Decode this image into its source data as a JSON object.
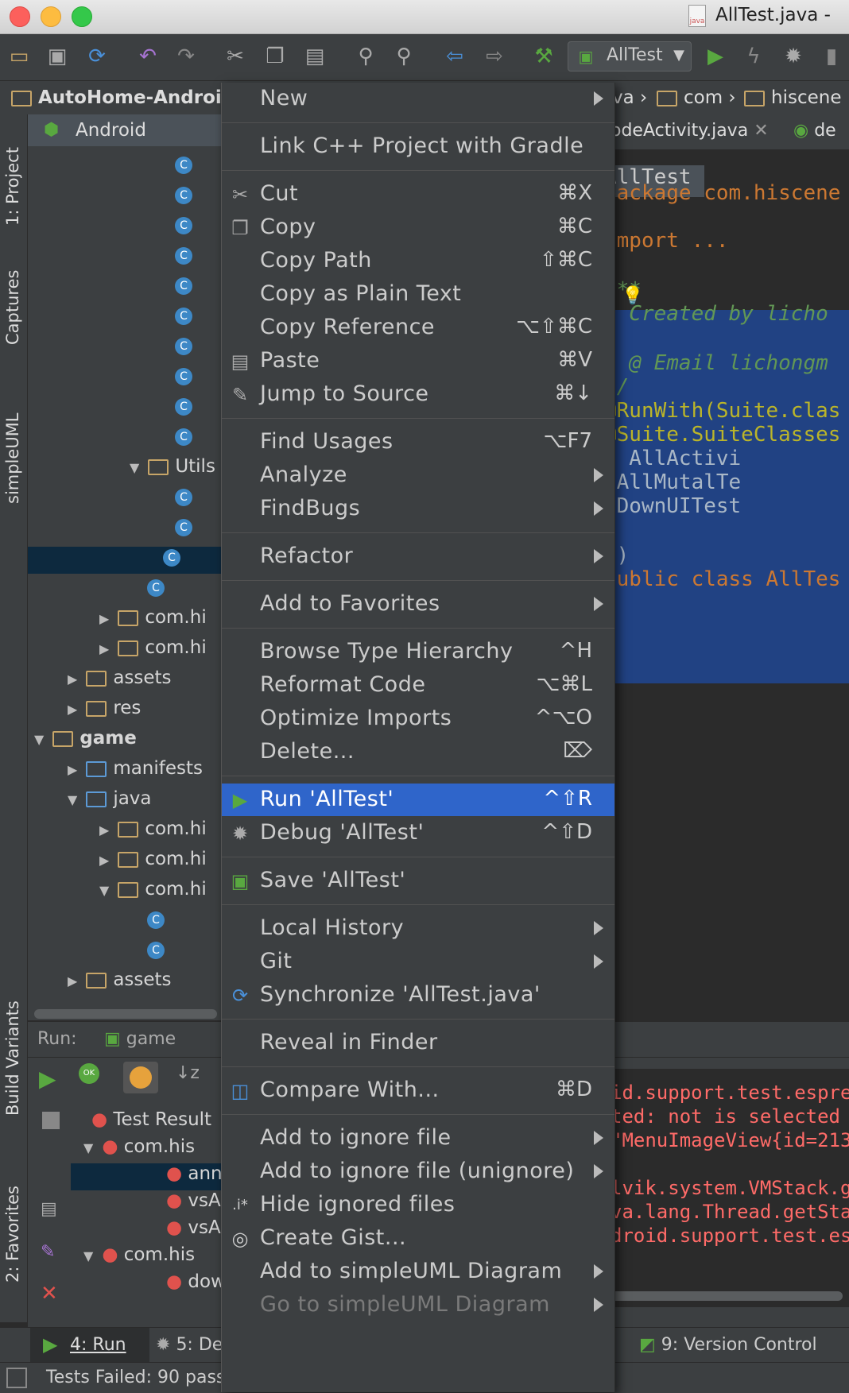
{
  "window": {
    "title": "AllTest.java -"
  },
  "toolbar": {
    "run_config": "AllTest"
  },
  "breadcrumbs": [
    "AutoHome-Android",
    "va",
    "com",
    "hiscene"
  ],
  "left_stripe": {
    "project_tab": "1: Project",
    "captures_tab": "Captures",
    "simpleuml_tab": "simpleUML",
    "build_variants_tab": "Build Variants",
    "favorites_tab": "2: Favorites"
  },
  "project": {
    "header": "Android",
    "rows": [
      "Utils",
      "com.hi",
      "com.hi",
      "assets",
      "res",
      "game",
      "manifests",
      "java",
      "com.hi",
      "com.hi",
      "com.hi",
      "assets"
    ]
  },
  "editor": {
    "tabs": [
      "odeActivity.java",
      "de"
    ],
    "class_label": "AllTest",
    "lines": [
      {
        "text": "package com.hiscene",
        "color": "#cc7832"
      },
      {
        "text": "import ...",
        "color": "#cc7832"
      },
      {
        "text": "/**",
        "color": "#629755"
      },
      {
        "text": " * Created by licho",
        "color": "#629755"
      },
      {
        "text": " *",
        "color": "#629755"
      },
      {
        "text": " * @ Email lichongm",
        "color": "#629755"
      },
      {
        "text": " */",
        "color": "#629755"
      },
      {
        "text": "@RunWith(Suite.clas",
        "color": "#bbb529"
      },
      {
        "text": "@Suite.SuiteClasses",
        "color": "#bbb529"
      },
      {
        "text": "      , AllActivi",
        "color": "#a9b7c6"
      },
      {
        "text": "      ,AllMutalTe",
        "color": "#a9b7c6"
      },
      {
        "text": "      ,DownUITest",
        "color": "#a9b7c6"
      },
      {
        "text": "})",
        "color": "#a9b7c6"
      },
      {
        "text": "public class AllTes",
        "color": "#cc7832"
      }
    ]
  },
  "run_panel": {
    "label": "Run:",
    "tab": "game",
    "tree": [
      "Test Result",
      "com.his",
      "ann",
      "vsA",
      "vsA",
      "com.his",
      "dow"
    ],
    "console": [
      "id.support.test.espre",
      "ted: not is selected",
      "\"MenuImageView{id=213",
      "lvik.system.VMStack.g",
      "va.lang.Thread.getSta",
      "droid.support.test.es"
    ]
  },
  "bottom_tabs": {
    "run": "4: Run",
    "debug": "5: De",
    "vcs": "9: Version Control"
  },
  "status": {
    "text": "Tests Failed: 90 pass"
  },
  "menu": [
    {
      "label": "New",
      "shortcut": "",
      "submenu": true,
      "icon": ""
    },
    {
      "sep": true
    },
    {
      "label": "Link C++ Project with Gradle",
      "shortcut": "",
      "submenu": false,
      "icon": ""
    },
    {
      "sep": true
    },
    {
      "label": "Cut",
      "shortcut": "⌘X",
      "submenu": false,
      "icon": "scissors-icon"
    },
    {
      "label": "Copy",
      "shortcut": "⌘C",
      "submenu": false,
      "icon": "copy-icon"
    },
    {
      "label": "Copy Path",
      "shortcut": "⇧⌘C",
      "submenu": false,
      "icon": ""
    },
    {
      "label": "Copy as Plain Text",
      "shortcut": "",
      "submenu": false,
      "icon": ""
    },
    {
      "label": "Copy Reference",
      "shortcut": "⌥⇧⌘C",
      "submenu": false,
      "icon": ""
    },
    {
      "label": "Paste",
      "shortcut": "⌘V",
      "submenu": false,
      "icon": "paste-icon"
    },
    {
      "label": "Jump to Source",
      "shortcut": "⌘↓",
      "submenu": false,
      "icon": "jump-to-source-icon"
    },
    {
      "sep": true
    },
    {
      "label": "Find Usages",
      "shortcut": "⌥F7",
      "submenu": false,
      "icon": ""
    },
    {
      "label": "Analyze",
      "shortcut": "",
      "submenu": true,
      "icon": ""
    },
    {
      "label": "FindBugs",
      "shortcut": "",
      "submenu": true,
      "icon": ""
    },
    {
      "sep": true
    },
    {
      "label": "Refactor",
      "shortcut": "",
      "submenu": true,
      "icon": ""
    },
    {
      "sep": true
    },
    {
      "label": "Add to Favorites",
      "shortcut": "",
      "submenu": true,
      "icon": ""
    },
    {
      "sep": true
    },
    {
      "label": "Browse Type Hierarchy",
      "shortcut": "^H",
      "submenu": false,
      "icon": ""
    },
    {
      "label": "Reformat Code",
      "shortcut": "⌥⌘L",
      "submenu": false,
      "icon": ""
    },
    {
      "label": "Optimize Imports",
      "shortcut": "^⌥O",
      "submenu": false,
      "icon": ""
    },
    {
      "label": "Delete...",
      "shortcut": "⌦",
      "submenu": false,
      "icon": ""
    },
    {
      "sep": true
    },
    {
      "label": "Run 'AllTest'",
      "shortcut": "^⇧R",
      "submenu": false,
      "icon": "run-icon",
      "highlight": true
    },
    {
      "label": "Debug 'AllTest'",
      "shortcut": "^⇧D",
      "submenu": false,
      "icon": "debug-icon"
    },
    {
      "sep": true
    },
    {
      "label": "Save 'AllTest'",
      "shortcut": "",
      "submenu": false,
      "icon": "save-config-icon"
    },
    {
      "sep": true
    },
    {
      "label": "Local History",
      "shortcut": "",
      "submenu": true,
      "icon": ""
    },
    {
      "label": "Git",
      "shortcut": "",
      "submenu": true,
      "icon": ""
    },
    {
      "label": "Synchronize 'AllTest.java'",
      "shortcut": "",
      "submenu": false,
      "icon": "sync-icon"
    },
    {
      "sep": true
    },
    {
      "label": "Reveal in Finder",
      "shortcut": "",
      "submenu": false,
      "icon": ""
    },
    {
      "sep": true
    },
    {
      "label": "Compare With...",
      "shortcut": "⌘D",
      "submenu": false,
      "icon": "compare-icon"
    },
    {
      "sep": true
    },
    {
      "label": "Add to ignore file",
      "shortcut": "",
      "submenu": true,
      "icon": ""
    },
    {
      "label": "Add to ignore file (unignore)",
      "shortcut": "",
      "submenu": true,
      "icon": ""
    },
    {
      "label": "Hide ignored files",
      "shortcut": "",
      "submenu": false,
      "icon": "ignored-files-icon"
    },
    {
      "label": "Create Gist...",
      "shortcut": "",
      "submenu": false,
      "icon": "github-icon"
    },
    {
      "label": "Add to simpleUML Diagram",
      "shortcut": "",
      "submenu": true,
      "icon": ""
    },
    {
      "label": "Go to simpleUML Diagram",
      "shortcut": "",
      "submenu": true,
      "icon": "",
      "disabled": true
    }
  ]
}
